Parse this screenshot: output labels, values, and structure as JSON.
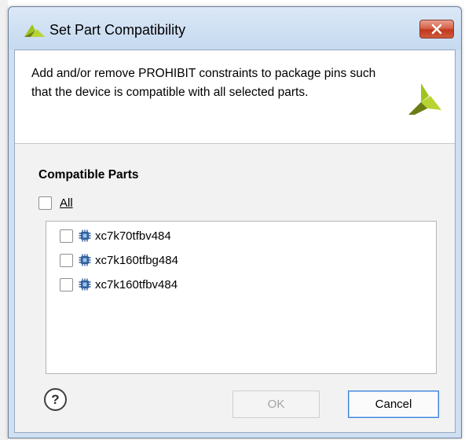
{
  "window": {
    "title": "Set Part Compatibility"
  },
  "header": {
    "description": "Add and/or remove PROHIBIT constraints to package pins such that the device is compatible with all selected parts."
  },
  "compatible_parts": {
    "label": "Compatible Parts",
    "all_label": "All",
    "all_checked": false,
    "items": [
      {
        "label": "xc7k70tfbv484",
        "checked": false,
        "icon": "chip-icon"
      },
      {
        "label": "xc7k160tfbg484",
        "checked": false,
        "icon": "chip-icon"
      },
      {
        "label": "xc7k160tfbv484",
        "checked": false,
        "icon": "chip-icon"
      }
    ]
  },
  "buttons": {
    "help_label": "?",
    "ok_label": "OK",
    "ok_enabled": false,
    "cancel_label": "Cancel"
  },
  "colors": {
    "logo_green": "#9fc41c",
    "logo_olive": "#6b7d12",
    "close_red": "#c2381d",
    "chip_blue": "#2f5f9e"
  }
}
